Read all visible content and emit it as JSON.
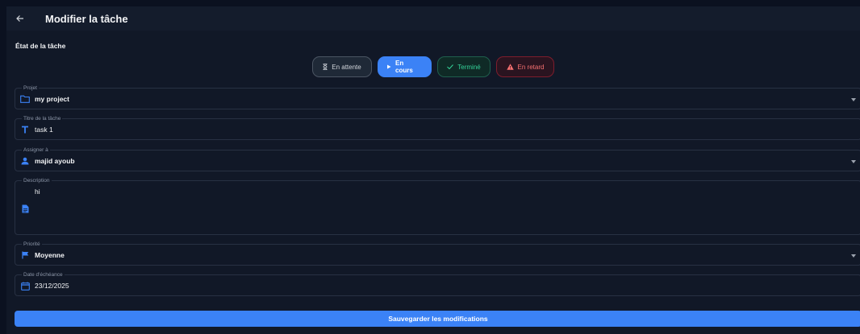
{
  "appbar": {
    "title": "Modifier la tâche"
  },
  "status": {
    "label": "État de la tâche",
    "chips": [
      {
        "label": "En attente",
        "icon": "hourglass-icon",
        "color": "#d1d5db"
      },
      {
        "label": "En cours",
        "icon": "play-icon",
        "color": "#3b82f6",
        "selected": true
      },
      {
        "label": "Terminé",
        "icon": "check-icon",
        "color": "#34d399"
      },
      {
        "label": "En retard",
        "icon": "warning-icon",
        "color": "#f87171"
      }
    ]
  },
  "form": {
    "project": {
      "label": "Projet",
      "value": "my project",
      "icon": "folder-icon"
    },
    "title": {
      "label": "Titre de la tâche",
      "value": "task 1",
      "icon": "text-icon"
    },
    "assignee": {
      "label": "Assigner à",
      "value": "majid ayoub",
      "icon": "person-icon"
    },
    "description": {
      "label": "Description",
      "value": "hi",
      "icon": "document-icon"
    },
    "priority": {
      "label": "Priorité",
      "value": "Moyenne",
      "icon": "flag-icon"
    },
    "due_date": {
      "label": "Date d'échéance",
      "value": "23/12/2025",
      "icon": "calendar-icon"
    }
  },
  "actions": {
    "save_label": "Sauvegarder les modifications"
  },
  "colors": {
    "accent": "#3b82f6",
    "background": "#0b1120",
    "surface": "#111827"
  }
}
